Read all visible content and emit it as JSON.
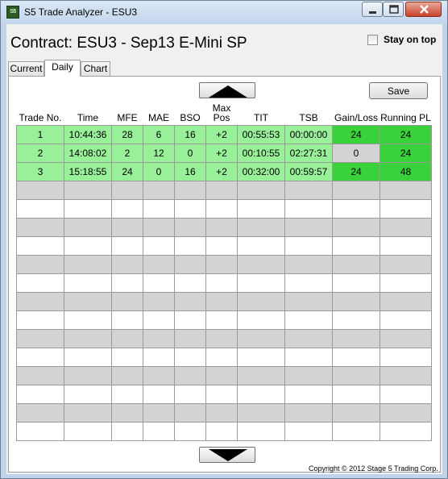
{
  "window": {
    "icon_text": "S5",
    "title": "S5 Trade Analyzer - ESU3"
  },
  "header": {
    "contract_title": "Contract: ESU3 - Sep13 E-Mini SP",
    "stay_on_top_label": "Stay on top",
    "stay_on_top_checked": false
  },
  "tabs": [
    {
      "label": "Current",
      "active": false
    },
    {
      "label": "Daily",
      "active": true
    },
    {
      "label": "Chart",
      "active": false
    }
  ],
  "toolbar": {
    "save_label": "Save"
  },
  "table": {
    "columns": [
      "Trade No.",
      "Time",
      "MFE",
      "MAE",
      "BSO",
      "Max Pos",
      "TIT",
      "TSB",
      "Gain/Loss",
      "Running PL"
    ],
    "rows": [
      {
        "cells": [
          "1",
          "10:44:36",
          "28",
          "6",
          "16",
          "+2",
          "00:55:53",
          "00:00:00",
          "24",
          "24"
        ],
        "gain_status": "green"
      },
      {
        "cells": [
          "2",
          "14:08:02",
          "2",
          "12",
          "0",
          "+2",
          "00:10:55",
          "02:27:31",
          "0",
          "24"
        ],
        "gain_status": "gray"
      },
      {
        "cells": [
          "3",
          "15:18:55",
          "24",
          "0",
          "16",
          "+2",
          "00:32:00",
          "00:59:57",
          "24",
          "48"
        ],
        "gain_status": "green"
      }
    ],
    "empty_row_count": 14
  },
  "colors": {
    "row_light_green": "#98f098",
    "cell_green": "#3ad23a",
    "cell_gray": "#d3d3d3"
  },
  "icons": {
    "scroll_up": "up-triangle-icon",
    "scroll_down": "down-triangle-icon"
  },
  "footer": {
    "copyright": "Copyright © 2012 Stage 5 Trading Corp."
  }
}
